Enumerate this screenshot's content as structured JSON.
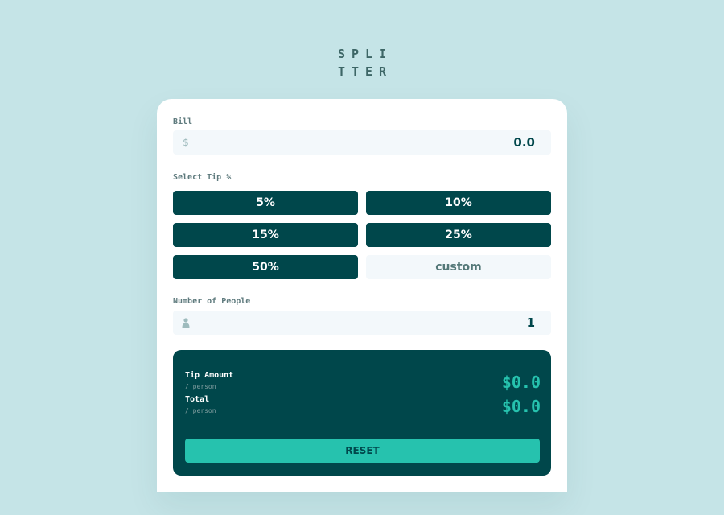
{
  "logo": {
    "line1": "SPLI",
    "line2": "TTER"
  },
  "bill": {
    "label": "Bill",
    "icon": "dollar-icon",
    "icon_glyph": "$",
    "value": "0.0"
  },
  "tip": {
    "label": "Select Tip %",
    "options": [
      "5%",
      "10%",
      "15%",
      "25%",
      "50%"
    ],
    "custom_label": "custom"
  },
  "people": {
    "label": "Number of People",
    "icon": "person-icon",
    "value": "1"
  },
  "results": {
    "tip_title": "Tip Amount",
    "tip_sub": "/ person",
    "tip_amount": "$0.0",
    "total_title": "Total",
    "total_sub": "/ person",
    "total_amount": "$0.0",
    "reset_label": "RESET"
  },
  "colors": {
    "background": "#c5e4e7",
    "dark_cyan": "#00474b",
    "strong_cyan": "#26c2ae",
    "input_bg": "#f3f8fb"
  }
}
